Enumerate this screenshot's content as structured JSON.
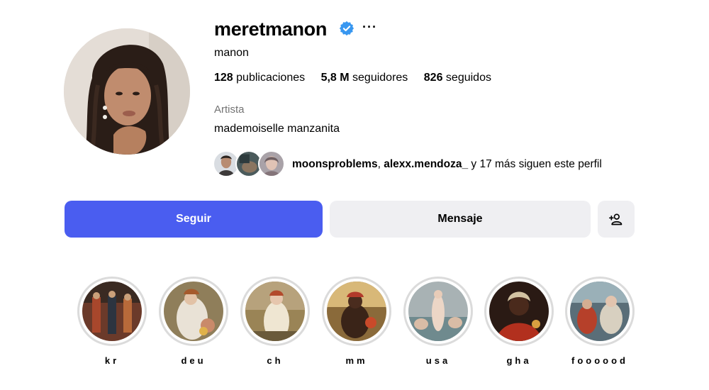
{
  "profile": {
    "username": "meretmanon",
    "verified_icon": "verified-badge-icon",
    "more_label": "···",
    "full_name": "manon",
    "stats": {
      "posts_count": "128",
      "posts_label": "publicaciones",
      "followers_count": "5,8 M",
      "followers_label": "seguidores",
      "following_count": "826",
      "following_label": "seguidos"
    },
    "category": "Artista",
    "bio": "mademoiselle manzanita",
    "followed_by": {
      "user1": "moonsproblems",
      "separator": ",",
      "user2": "alexx.mendoza_",
      "suffix": "y 17 más siguen este perfil"
    }
  },
  "actions": {
    "follow_label": "Seguir",
    "message_label": "Mensaje",
    "add_user_icon": "add-person-icon"
  },
  "highlights": [
    {
      "label": "kr"
    },
    {
      "label": "deu"
    },
    {
      "label": "ch"
    },
    {
      "label": "mm"
    },
    {
      "label": "usa"
    },
    {
      "label": "gha"
    },
    {
      "label": "foooood"
    }
  ],
  "colors": {
    "accent": "#4a5df0",
    "verified": "#3897f0",
    "secondary_button": "#efeff2",
    "muted_text": "#737373",
    "highlight_ring": "#dbdbdb"
  }
}
